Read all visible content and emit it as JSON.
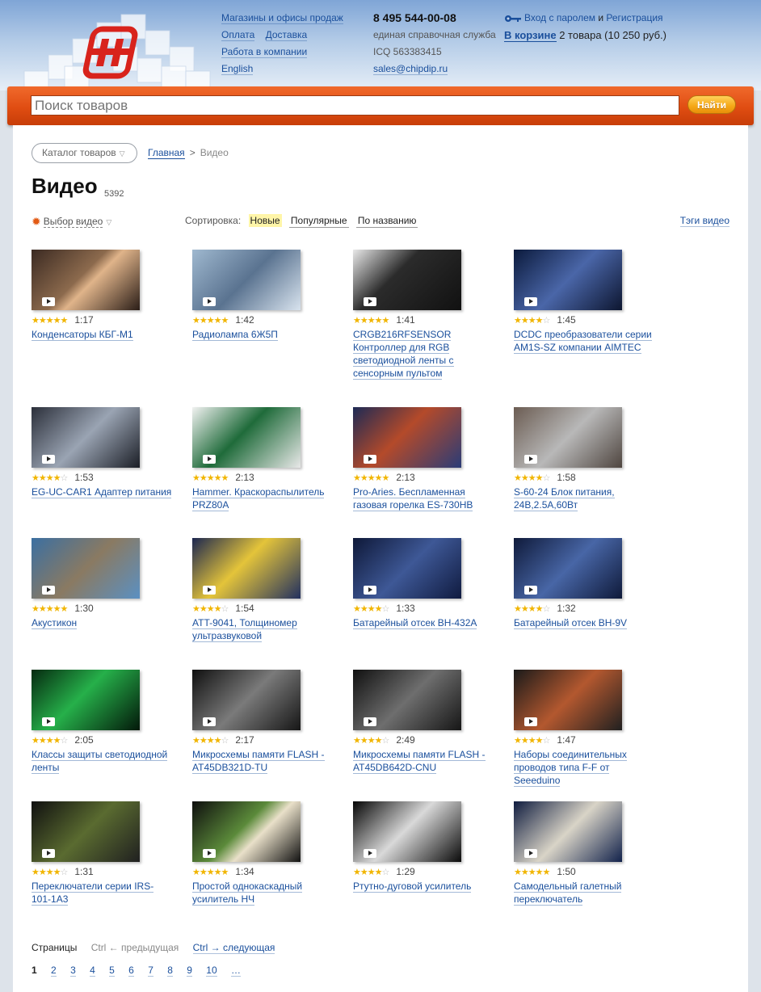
{
  "header": {
    "links": {
      "stores": "Магазины и офисы продаж",
      "payment": "Оплата",
      "delivery": "Доставка",
      "jobs": "Работа в компании",
      "english": "English"
    },
    "contact": {
      "phone": "8 495 544-00-08",
      "phone_caption": "единая справочная служба",
      "icq": "ICQ 563383415",
      "email": "sales@chipdip.ru"
    },
    "user": {
      "login": "Вход с паролем",
      "and": "и",
      "register": "Регистрация",
      "cart_link": "В корзине",
      "cart_summary": "2 товара (10 250 руб.)"
    }
  },
  "search": {
    "placeholder": "Поиск товаров",
    "button": "Найти"
  },
  "catalog_button": "Каталог товаров",
  "breadcrumb": {
    "home": "Главная",
    "sep": ">",
    "current": "Видео"
  },
  "page": {
    "title": "Видео",
    "count": "5392"
  },
  "filters": {
    "video_select": "Выбор видео",
    "sort_label": "Сортировка:",
    "sort_options": [
      "Новые",
      "Популярные",
      "По названию"
    ],
    "tags_link": "Тэги видео"
  },
  "videos": [
    {
      "title": "Конденсаторы КБГ-М1",
      "duration": "1:17",
      "rating": 5
    },
    {
      "title": "Радиолампа 6Ж5П",
      "duration": "1:42",
      "rating": 5
    },
    {
      "title": "CRGB216RFSENSOR Контроллер для RGB светодиодной ленты с сенсорным пультом",
      "duration": "1:41",
      "rating": 5
    },
    {
      "title": "DCDC преобразователи серии AM1S-SZ компании AIMTEC",
      "duration": "1:45",
      "rating": 4
    },
    {
      "title": "EG-UC-CAR1 Адаптер питания",
      "duration": "1:53",
      "rating": 4
    },
    {
      "title": "Hammer. Краскораспылитель PRZ80A",
      "duration": "2:13",
      "rating": 5
    },
    {
      "title": "Pro-Aries. Беспламенная газовая горелка ES-730HB",
      "duration": "2:13",
      "rating": 5
    },
    {
      "title": "S-60-24 Блок питания, 24В,2.5А,60Вт",
      "duration": "1:58",
      "rating": 4
    },
    {
      "title": "Акустикон",
      "duration": "1:30",
      "rating": 5
    },
    {
      "title": "ATT-9041, Толщиномер ультразвуковой",
      "duration": "1:54",
      "rating": 4
    },
    {
      "title": "Батарейный отсек BH-432A",
      "duration": "1:33",
      "rating": 4
    },
    {
      "title": "Батарейный отсек BH-9V",
      "duration": "1:32",
      "rating": 4
    },
    {
      "title": "Классы защиты светодиодной ленты",
      "duration": "2:05",
      "rating": 4
    },
    {
      "title": "Микросхемы памяти FLASH - AT45DB321D-TU",
      "duration": "2:17",
      "rating": 4
    },
    {
      "title": "Микросхемы памяти FLASH - AT45DB642D-CNU",
      "duration": "2:49",
      "rating": 4
    },
    {
      "title": "Наборы соединительных проводов типа F-F от Seeeduino",
      "duration": "1:47",
      "rating": 4
    },
    {
      "title": "Переключатели серии IRS-101-1A3",
      "duration": "1:31",
      "rating": 4
    },
    {
      "title": "Простой однокаскадный усилитель НЧ",
      "duration": "1:34",
      "rating": 5
    },
    {
      "title": "Ртутно-дуговой усилитель",
      "duration": "1:29",
      "rating": 4
    },
    {
      "title": "Самодельный галетный переключатель",
      "duration": "1:50",
      "rating": 5
    }
  ],
  "pagination": {
    "label": "Страницы",
    "prev": "Ctrl ← предыдущая",
    "next": "Ctrl → следующая",
    "current": "1",
    "pages": [
      "2",
      "3",
      "4",
      "5",
      "6",
      "7",
      "8",
      "9",
      "10",
      "…"
    ]
  },
  "colors": {
    "search_bar": "#e04d12",
    "link": "#1a4f9c",
    "star": "#f1b500",
    "search_button": "#f5a716"
  }
}
